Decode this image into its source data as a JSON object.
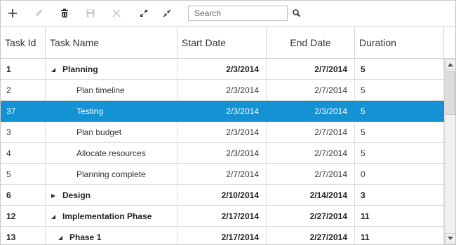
{
  "toolbar": {
    "buttons": [
      {
        "name": "add-button",
        "icon": "plus-icon"
      },
      {
        "name": "edit-button",
        "icon": "pencil-icon"
      },
      {
        "name": "delete-button",
        "icon": "trash-icon"
      },
      {
        "name": "save-button",
        "icon": "save-icon"
      },
      {
        "name": "cancel-button",
        "icon": "close-icon"
      },
      {
        "name": "expand-all-button",
        "icon": "expand-icon"
      },
      {
        "name": "collapse-all-button",
        "icon": "collapse-icon"
      }
    ],
    "search_placeholder": "Search"
  },
  "columns": {
    "task_id": "Task Id",
    "task_name": "Task Name",
    "start_date": "Start Date",
    "end_date": "End Date",
    "duration": "Duration"
  },
  "rows": [
    {
      "id": "1",
      "name": "Planning",
      "start": "2/3/2014",
      "end": "2/7/2014",
      "duration": "5",
      "parent": true,
      "expanded": true,
      "level": 0,
      "selected": false
    },
    {
      "id": "2",
      "name": "Plan timeline",
      "start": "2/3/2014",
      "end": "2/7/2014",
      "duration": "5",
      "parent": false,
      "level": 1,
      "selected": false
    },
    {
      "id": "37",
      "name": "Testing",
      "start": "2/3/2014",
      "end": "2/3/2014",
      "duration": "5",
      "parent": false,
      "level": 1,
      "selected": true
    },
    {
      "id": "3",
      "name": "Plan budget",
      "start": "2/3/2014",
      "end": "2/7/2014",
      "duration": "5",
      "parent": false,
      "level": 1,
      "selected": false
    },
    {
      "id": "4",
      "name": "Allocate resources",
      "start": "2/3/2014",
      "end": "2/7/2014",
      "duration": "5",
      "parent": false,
      "level": 1,
      "selected": false
    },
    {
      "id": "5",
      "name": "Planning complete",
      "start": "2/7/2014",
      "end": "2/7/2014",
      "duration": "0",
      "parent": false,
      "level": 1,
      "selected": false
    },
    {
      "id": "6",
      "name": "Design",
      "start": "2/10/2014",
      "end": "2/14/2014",
      "duration": "3",
      "parent": true,
      "expanded": false,
      "level": 0,
      "selected": false
    },
    {
      "id": "12",
      "name": "Implementation Phase",
      "start": "2/17/2014",
      "end": "2/27/2014",
      "duration": "11",
      "parent": true,
      "expanded": true,
      "level": 0,
      "selected": false
    },
    {
      "id": "13",
      "name": "Phase 1",
      "start": "2/17/2014",
      "end": "2/27/2014",
      "duration": "11",
      "parent": true,
      "expanded": true,
      "level": 1,
      "selected": false
    }
  ],
  "colors": {
    "selected_row": "#1592d4"
  }
}
